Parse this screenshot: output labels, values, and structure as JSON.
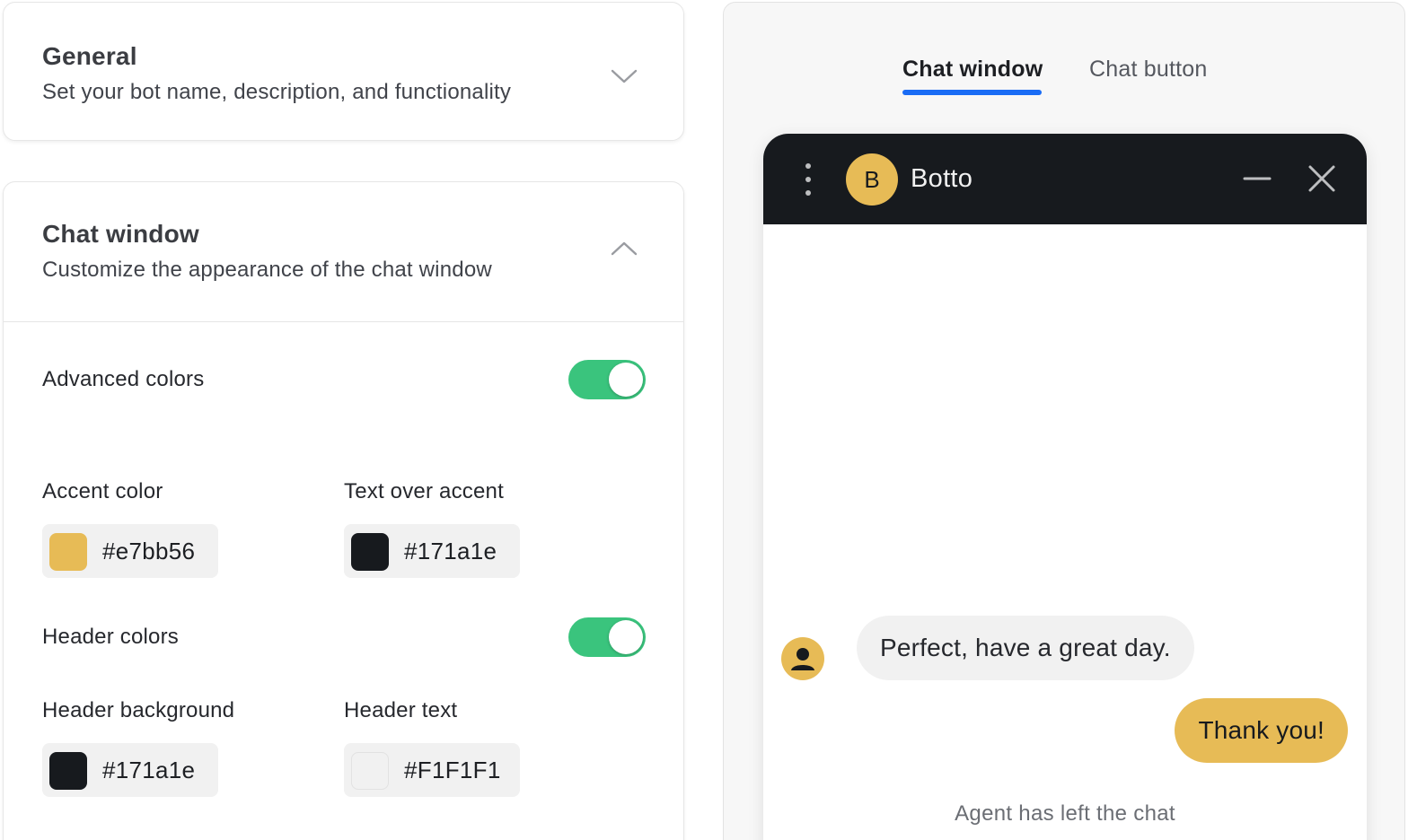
{
  "sections": {
    "general": {
      "title": "General",
      "subtitle": "Set your bot name, description, and functionality",
      "expanded": false
    },
    "chat_window": {
      "title": "Chat window",
      "subtitle": "Customize the appearance of the chat window",
      "expanded": true,
      "advanced_colors": {
        "label": "Advanced colors",
        "enabled": true
      },
      "accent_color": {
        "label": "Accent color",
        "value": "#e7bb56"
      },
      "text_over_accent": {
        "label": "Text over accent",
        "value": "#171a1e"
      },
      "header_colors": {
        "label": "Header colors",
        "enabled": true
      },
      "header_background": {
        "label": "Header background",
        "value": "#171a1e"
      },
      "header_text": {
        "label": "Header text",
        "value": "#F1F1F1"
      }
    }
  },
  "preview": {
    "tabs": [
      {
        "label": "Chat window",
        "active": true
      },
      {
        "label": "Chat button",
        "active": false
      }
    ],
    "chat": {
      "bot_initial": "B",
      "bot_name": "Botto",
      "messages": [
        {
          "from": "agent",
          "text": "Perfect, have a great day."
        },
        {
          "from": "user",
          "text": "Thank you!"
        }
      ],
      "system_message": "Agent has left the chat"
    }
  },
  "colors": {
    "accent": "#e7bb56",
    "dark": "#171a1e",
    "light": "#F1F1F1",
    "toggle_on": "#3ac47d",
    "tab_underline": "#1a6cf5"
  },
  "icons": {
    "general_chevron": "chevron-down-icon",
    "chat_chevron": "chevron-up-icon",
    "menu": "kebab-menu-icon",
    "minimize": "minimize-icon",
    "close": "close-icon",
    "user": "user-icon"
  }
}
